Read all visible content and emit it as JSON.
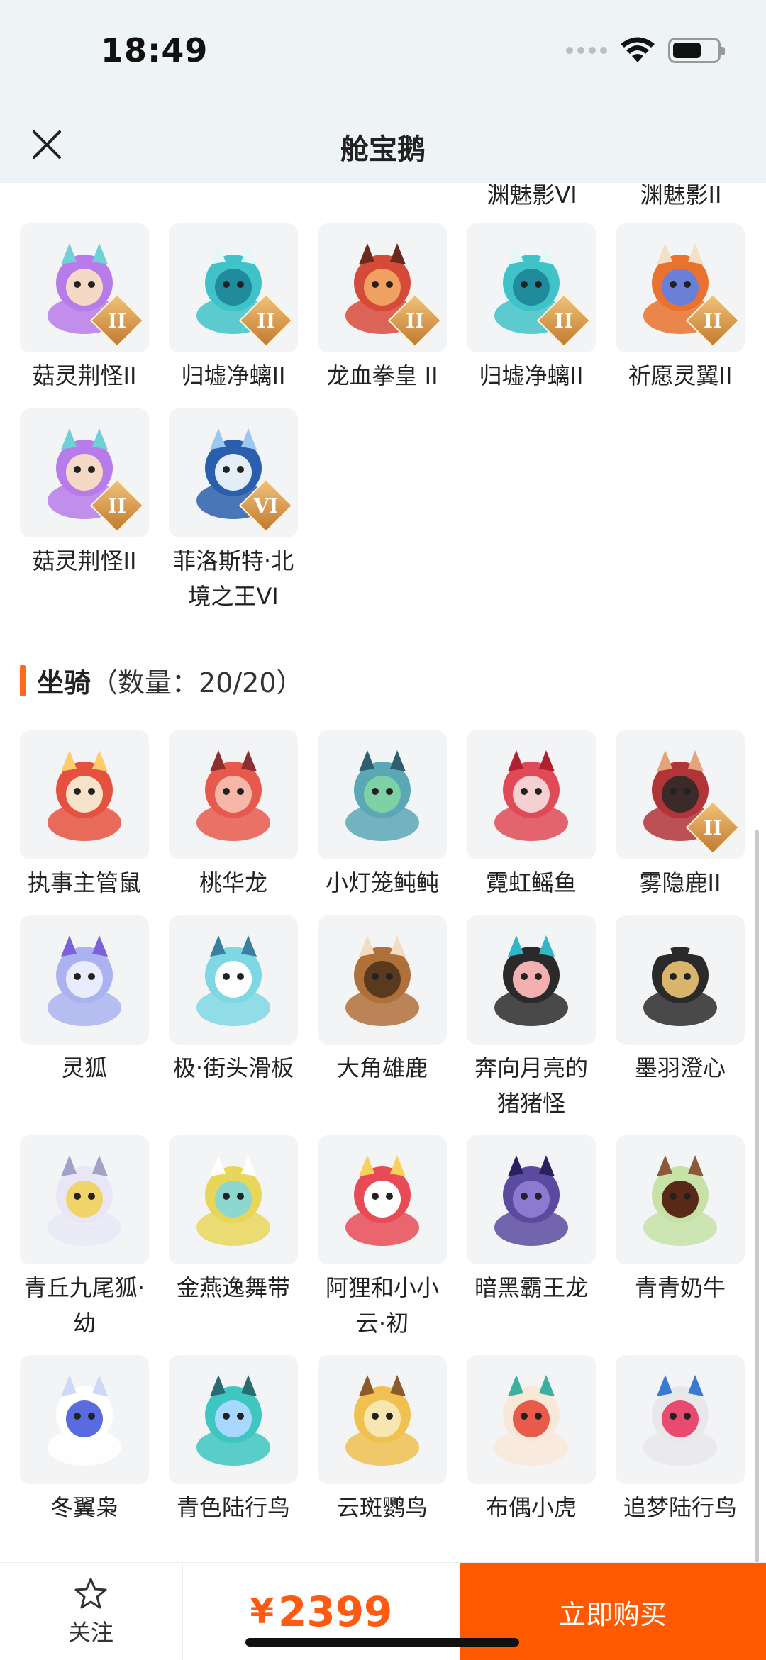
{
  "status": {
    "time": "18:49"
  },
  "header": {
    "title": "舱宝鹅"
  },
  "cut_labels": [
    "渊魅影VI",
    "渊魅影II"
  ],
  "pets": [
    {
      "label": "菇灵荆怪II",
      "badge": "II",
      "icon": "purple-hair-elf-icon"
    },
    {
      "label": "归墟净螭II",
      "badge": "II",
      "icon": "teal-dragon-icon"
    },
    {
      "label": "龙血拳皇 II",
      "badge": "II",
      "icon": "red-ram-beast-icon"
    },
    {
      "label": "归墟净螭II",
      "badge": "II",
      "icon": "teal-dragon-icon"
    },
    {
      "label": "祈愿灵翼II",
      "badge": "II",
      "icon": "phoenix-bird-icon"
    },
    {
      "label": "菇灵荆怪II",
      "badge": "II",
      "icon": "purple-hair-elf-icon"
    },
    {
      "label": "菲洛斯特·北境之王VI",
      "badge": "VI",
      "icon": "ice-king-icon"
    }
  ],
  "section": {
    "title": "坐骑",
    "count_text": "（数量：20/20）"
  },
  "mounts": [
    {
      "label": "执事主管鼠",
      "badge": "",
      "icon": "butler-mouse-icon"
    },
    {
      "label": "桃华龙",
      "badge": "",
      "icon": "peach-dragon-icon"
    },
    {
      "label": "小灯笼鲀鲀",
      "badge": "",
      "icon": "lantern-puffer-icon"
    },
    {
      "label": "霓虹鳐鱼",
      "badge": "",
      "icon": "neon-ray-icon"
    },
    {
      "label": "雾隐鹿II",
      "badge": "II",
      "icon": "mist-deer-icon"
    },
    {
      "label": "灵狐",
      "badge": "",
      "icon": "spirit-fox-icon"
    },
    {
      "label": "极·街头滑板",
      "badge": "",
      "icon": "skateboard-icon"
    },
    {
      "label": "大角雄鹿",
      "badge": "",
      "icon": "stag-icon"
    },
    {
      "label": "奔向月亮的猪猪怪",
      "badge": "",
      "icon": "moon-pig-icon"
    },
    {
      "label": "墨羽澄心",
      "badge": "",
      "icon": "ink-feather-icon"
    },
    {
      "label": "青丘九尾狐·幼",
      "badge": "",
      "icon": "nine-tail-fox-icon"
    },
    {
      "label": "金燕逸舞带",
      "badge": "",
      "icon": "golden-ribbon-icon"
    },
    {
      "label": "阿狸和小小云·初",
      "badge": "",
      "icon": "ahri-cloud-icon"
    },
    {
      "label": "暗黑霸王龙",
      "badge": "",
      "icon": "dark-trex-icon"
    },
    {
      "label": "青青奶牛",
      "badge": "",
      "icon": "green-cow-icon"
    },
    {
      "label": "冬翼枭",
      "badge": "",
      "icon": "winter-owl-icon"
    },
    {
      "label": "青色陆行鸟",
      "badge": "",
      "icon": "cyan-chocobo-icon"
    },
    {
      "label": "云斑鹦鸟",
      "badge": "",
      "icon": "cockatoo-icon"
    },
    {
      "label": "布偶小虎",
      "badge": "",
      "icon": "plush-tiger-icon"
    },
    {
      "label": "追梦陆行鸟",
      "badge": "",
      "icon": "dream-chocobo-icon"
    }
  ],
  "bottom": {
    "fav_label": "关注",
    "price_symbol": "¥",
    "price": "2399",
    "buy_label": "立即购买",
    "accent": "#ff5a00"
  }
}
